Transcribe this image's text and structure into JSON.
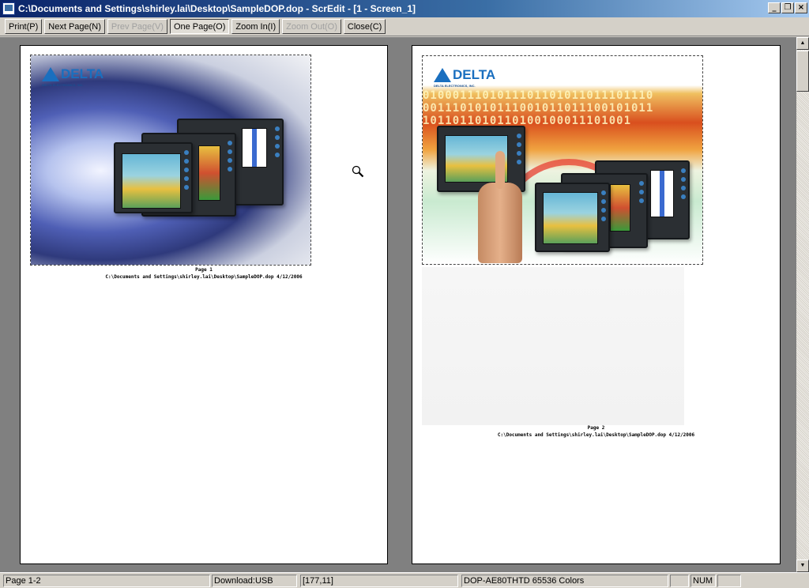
{
  "window": {
    "title": "C:\\Documents and Settings\\shirley.lai\\Desktop\\SampleDOP.dop - ScrEdit - [1 - Screen_1]",
    "minimize": "_",
    "restore": "❐",
    "close": "×"
  },
  "toolbar": {
    "print": "Print(P)",
    "next_page": "Next Page(N)",
    "prev_page": "Prev Page(V)",
    "one_page": "One Page(O)",
    "zoom_in": "Zoom In(I)",
    "zoom_out": "Zoom Out(O)",
    "close": "Close(C)"
  },
  "pages": [
    {
      "logo": "DELTA",
      "logo_sub": "DELTA ELECTRONICS, INC.",
      "caption_page": "Page 1",
      "caption_path": "C:\\Documents and Settings\\shirley.lai\\Desktop\\SampleDOP.dop 4/12/2006"
    },
    {
      "logo": "DELTA",
      "logo_sub": "DELTA ELECTRONICS, INC.",
      "binary": "0100011101011101101011011101110\n0011101010111001011011100101011\n1011011010110100100011101001",
      "caption_page": "Page 2",
      "caption_path": "C:\\Documents and Settings\\shirley.lai\\Desktop\\SampleDOP.dop 4/12/2006"
    }
  ],
  "scrollbar": {
    "up": "▲",
    "down": "▼"
  },
  "status": {
    "pages": "Page 1-2",
    "download": "Download:USB",
    "coords": "[177,11]",
    "model": "DOP-AE80THTD 65536 Colors",
    "num": "NUM"
  }
}
